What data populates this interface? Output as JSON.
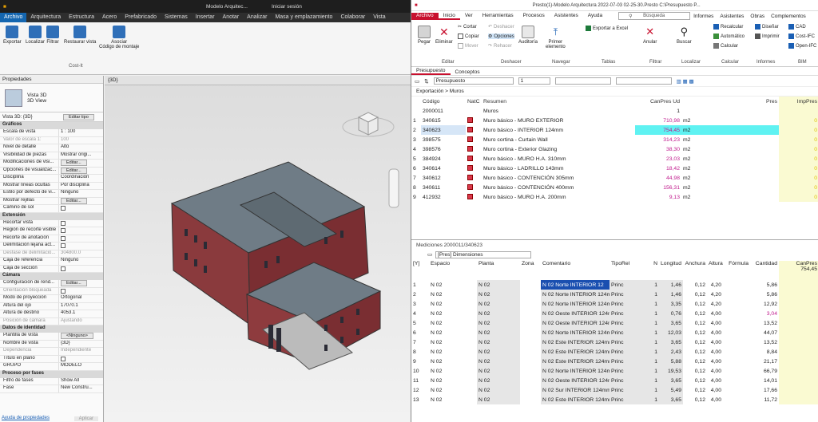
{
  "revit": {
    "title_text": "Modelo Arquitec...",
    "search_text": "Iniciar sesión",
    "menu": [
      "Archivo",
      "Arquitectura",
      "Estructura",
      "Acero",
      "Prefabricado",
      "Sistemas",
      "Insertar",
      "Anotar",
      "Analizar",
      "Masa y emplazamiento",
      "Colaborar",
      "Vista"
    ],
    "ribbon_buttons": [
      "Exportar",
      "Localizar",
      "Filtrar",
      "Restaurar vista"
    ],
    "asociar_label": "Asociar\nCódigo de montaje",
    "group_label": "Cost-It",
    "props_title": "Propiedades",
    "type_name": "Vista 3D",
    "type_sub": "3D View",
    "view_select": "Vista 3D: {3D}",
    "edit_type": "Editar tipo",
    "sections": [
      {
        "name": "Gráficos",
        "rows": [
          [
            "Escala de vista",
            "1 : 100"
          ],
          [
            "Valor de escala    1:",
            "100"
          ],
          [
            "Nivel de detalle",
            "Alto"
          ],
          [
            "Visibilidad de piezas",
            "Mostrar origi..."
          ],
          [
            "Modificaciones de visi...",
            "Editar..."
          ],
          [
            "Opciones de visualizac...",
            "Editar..."
          ],
          [
            "Disciplina",
            "Coordinación"
          ],
          [
            "Mostrar líneas ocultas",
            "Por disciplina"
          ],
          [
            "Estilo por defecto de vi...",
            "Ninguno"
          ],
          [
            "Mostrar rejillas",
            "Editar..."
          ],
          [
            "Camino de sol",
            ""
          ]
        ]
      },
      {
        "name": "Extensión",
        "rows": [
          [
            "Recortar vista",
            ""
          ],
          [
            "Región de recorte visible",
            ""
          ],
          [
            "Recorte de anotación",
            ""
          ],
          [
            "Delimitación lejana act...",
            ""
          ],
          [
            "Desfase de delimitació...",
            "304800.0"
          ],
          [
            "Caja de referencia",
            "Ninguno"
          ],
          [
            "Caja de sección",
            ""
          ]
        ]
      },
      {
        "name": "Cámara",
        "rows": [
          [
            "Configuración de rend...",
            "Editar..."
          ],
          [
            "Orientación bloqueada",
            ""
          ],
          [
            "Modo de proyección",
            "Ortogonal"
          ],
          [
            "Altura del ojo",
            "17070.1"
          ],
          [
            "Altura de destino",
            "4053.1"
          ],
          [
            "Posición de cámara",
            "Ajustando"
          ]
        ]
      },
      {
        "name": "Datos de identidad",
        "rows": [
          [
            "Plantilla de vista",
            "<Ninguno>"
          ],
          [
            "Nombre de vista",
            "{3D}"
          ],
          [
            "Dependencia",
            "Independiente"
          ],
          [
            "Título en plano",
            ""
          ],
          [
            "GRUPO",
            "MODELO"
          ]
        ]
      },
      {
        "name": "Proceso por fases",
        "rows": [
          [
            "Filtro de fases",
            "Show All"
          ],
          [
            "Fase",
            "New Constru..."
          ]
        ]
      }
    ],
    "help_link": "Ayuda de propiedades",
    "apply": "Aplicar",
    "view_tab": "{3D}"
  },
  "presto": {
    "title": "Presto(1)-Modelo Arquitectura 2022-07-03 02-25-30.Presto C:\\Presupuesto P...",
    "menu": [
      "Archivo",
      "Inicio",
      "Ver",
      "Herramientas",
      "Procesos",
      "Asistentes",
      "Ayuda"
    ],
    "search_placeholder": "Búsqueda",
    "right_menu": [
      "Informes",
      "Asistentes",
      "Obras",
      "Complementos"
    ],
    "ribbon": {
      "pegar": "Pegar",
      "eliminar": "Eliminar",
      "cortar": "Cortar",
      "copiar": "Copiar",
      "mover": "Mover",
      "deshacer": "Deshacer",
      "opciones": "Opciones",
      "rehacer": "Rehacer",
      "auditoria": "Auditoría",
      "primer": "Primer\nelemento",
      "exportar_excel": "Exportar a Excel",
      "anular": "Anular",
      "buscar": "Buscar",
      "recalcular": "Recalcular",
      "automatico": "Automático",
      "calcular": "Calcular",
      "disenar": "Diseñar",
      "imprimir": "Imprimir",
      "cad": "CAD",
      "cost_ifc": "Cost-IFC",
      "open_ifc": "Open-IFC",
      "groups": [
        "Editar",
        "Deshacer",
        "Navegar",
        "Tablas",
        "Filtrar",
        "Localizar",
        "Calcular",
        "Informes",
        "BIM"
      ]
    },
    "tabs": [
      "Presupuesto",
      "Conceptos"
    ],
    "filter_select": "Presupuesto",
    "page_num": "1",
    "breadcrumb": "Exportación > Muros",
    "upper_headers": {
      "codigo": "Código",
      "natc": "NatC",
      "resumen": "Resumen",
      "canpres": "CanPres Ud",
      "pres": "Pres",
      "imppres": "ImpPres"
    },
    "upper_parent": {
      "codigo": "2000011",
      "resumen": "Muros",
      "canpres": "1"
    },
    "upper_rows": [
      [
        "1",
        "340615",
        "Muro básico - MURO EXTERIOR",
        "710,98",
        "m2",
        "0"
      ],
      [
        "2",
        "340623",
        "Muro básico - INTERIOR 124mm",
        "754,45",
        "m2",
        "0"
      ],
      [
        "3",
        "398575",
        "Muro cortina - Curtain Wall",
        "314,23",
        "m2",
        "0"
      ],
      [
        "4",
        "398576",
        "Muro cortina - Exterior Glazing",
        "38,30",
        "m2",
        "0"
      ],
      [
        "5",
        "384924",
        "Muro básico - MURO H.A. 310mm",
        "23,03",
        "m2",
        "0"
      ],
      [
        "6",
        "340614",
        "Muro básico - LADRILLO 143mm",
        "18,42",
        "m2",
        "0"
      ],
      [
        "7",
        "340612",
        "Muro básico - CONTENCIÓN 305mm",
        "44,98",
        "m2",
        "0"
      ],
      [
        "8",
        "340611",
        "Muro básico - CONTENCIÓN 400mm",
        "156,31",
        "m2",
        "0"
      ],
      [
        "9",
        "412932",
        "Muro básico - MURO H.A. 200mm",
        "9,13",
        "m2",
        "0"
      ]
    ],
    "lower_title": "Mediciones 2000011/340623",
    "lower_select": "[Pres] Dimensiones",
    "lower_headers": [
      "[Y]",
      "Espacio",
      "Planta",
      "Zona",
      "Comentario",
      "TipoRel",
      "N",
      "Longitud",
      "Anchura",
      "Altura",
      "Fórmula",
      "Cantidad",
      "CanPres"
    ],
    "lower_total": "754,45",
    "lower_rows": [
      [
        "1",
        "N 02",
        "N 02",
        "",
        "N 02 Norte INTERIOR 12",
        "Princ",
        "1",
        "1,46",
        "0,12",
        "4,20",
        "",
        "5,86"
      ],
      [
        "2",
        "N 02",
        "N 02",
        "",
        "N 02 Norte INTERIOR 124m",
        "Princ",
        "1",
        "1,46",
        "0,12",
        "4,20",
        "",
        "5,86"
      ],
      [
        "3",
        "N 02",
        "N 02",
        "",
        "N 02 Norte INTERIOR 124m",
        "Princ",
        "1",
        "3,35",
        "0,12",
        "4,20",
        "",
        "12,92"
      ],
      [
        "4",
        "N 02",
        "N 02",
        "",
        "N 02 Oeste INTERIOR 124m",
        "Princ",
        "1",
        "0,76",
        "0,12",
        "4,00",
        "",
        "3,04"
      ],
      [
        "5",
        "N 02",
        "N 02",
        "",
        "N 02 Oeste INTERIOR 124m",
        "Princ",
        "1",
        "3,65",
        "0,12",
        "4,00",
        "",
        "13,52"
      ],
      [
        "6",
        "N 02",
        "N 02",
        "",
        "N 02 Norte INTERIOR 124m",
        "Princ",
        "1",
        "12,03",
        "0,12",
        "4,00",
        "",
        "44,07"
      ],
      [
        "7",
        "N 02",
        "N 02",
        "",
        "N 02 Este INTERIOR 124mr",
        "Princ",
        "1",
        "3,65",
        "0,12",
        "4,00",
        "",
        "13,52"
      ],
      [
        "8",
        "N 02",
        "N 02",
        "",
        "N 02 Este INTERIOR 124mr",
        "Princ",
        "1",
        "2,43",
        "0,12",
        "4,00",
        "",
        "8,84"
      ],
      [
        "9",
        "N 02",
        "N 02",
        "",
        "N 02 Este INTERIOR 124mr",
        "Princ",
        "1",
        "5,88",
        "0,12",
        "4,00",
        "",
        "21,17"
      ],
      [
        "10",
        "N 02",
        "N 02",
        "",
        "N 02 Norte INTERIOR 124m",
        "Princ",
        "1",
        "19,53",
        "0,12",
        "4,00",
        "",
        "66,79"
      ],
      [
        "11",
        "N 02",
        "N 02",
        "",
        "N 02 Oeste INTERIOR 124m",
        "Princ",
        "1",
        "3,65",
        "0,12",
        "4,00",
        "",
        "14,01"
      ],
      [
        "12",
        "N 02",
        "N 02",
        "",
        "N 02 Sur INTERIOR 124mm",
        "Princ",
        "1",
        "5,49",
        "0,12",
        "4,00",
        "",
        "17,66"
      ],
      [
        "13",
        "N 02",
        "N 02",
        "",
        "N 02 Este INTERIOR 124mr",
        "Princ",
        "1",
        "3,65",
        "0,12",
        "4,00",
        "",
        "11,72"
      ]
    ]
  }
}
